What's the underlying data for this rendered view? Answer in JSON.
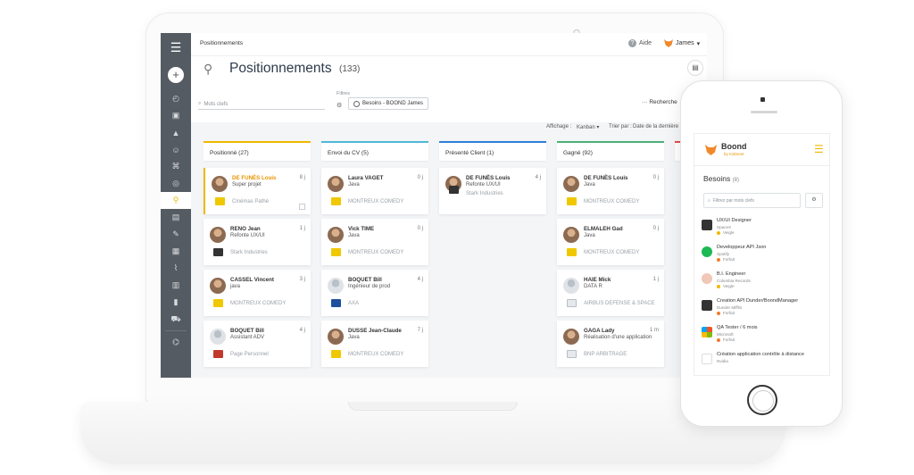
{
  "header": {
    "breadcrumb": "Positionnements",
    "help_label": "Aide",
    "user_name": "James"
  },
  "page": {
    "title": "Positionnements",
    "count": "(133)"
  },
  "filters": {
    "search_placeholder": "Mots clefs",
    "filters_label": "Filtres",
    "chip_label": "Besoins - BOOND James",
    "advanced_search": "Recherche"
  },
  "view": {
    "display_label": "Affichage :",
    "display_value": "Kanban ▾",
    "sort_label": "Trier par :",
    "sort_value": "Date de la dernière"
  },
  "kanban": {
    "columns": [
      {
        "title": "Positionné (27)",
        "color": "#f0b800",
        "cards": [
          {
            "name": "DE FUNÈS Louis",
            "role": "Super projet",
            "company": "Cinémas Pathé",
            "days": "8 j"
          },
          {
            "name": "RENO Jean",
            "role": "Refonte UX/UI",
            "company": "Stark Industries",
            "days": "1 j"
          },
          {
            "name": "CASSEL Vincent",
            "role": "java",
            "company": "MONTREUX COMEDY",
            "days": "3 j"
          },
          {
            "name": "BOQUET Bill",
            "role": "Assistant ADV",
            "company": "Page Personnel",
            "days": "4 j"
          }
        ]
      },
      {
        "title": "Envoi du CV (5)",
        "color": "#4fb8d8",
        "cards": [
          {
            "name": "Laura VAGET",
            "role": "Java",
            "company": "MONTREUX COMEDY",
            "days": "0 j"
          },
          {
            "name": "Vick TIME",
            "role": "Java",
            "company": "MONTREUX COMEDY",
            "days": "0 j"
          },
          {
            "name": "BOQUET Bill",
            "role": "Ingénieur de prod",
            "company": "AXA",
            "days": "4 j"
          },
          {
            "name": "DUSSE Jean-Claude",
            "role": "Java",
            "company": "MONTREUX COMEDY",
            "days": "7 j"
          }
        ]
      },
      {
        "title": "Présenté Client (1)",
        "color": "#2f7fd8",
        "cards": [
          {
            "name": "DE FUNÈS Louis",
            "role": "Refonte UX/UI",
            "company": "Stark Industries",
            "days": "4 j"
          }
        ]
      },
      {
        "title": "Gagné (92)",
        "color": "#4caf7a",
        "cards": [
          {
            "name": "DE FUNÈS Louis",
            "role": "Java",
            "company": "MONTREUX COMEDY",
            "days": "0 j"
          },
          {
            "name": "ELMALEH Gad",
            "role": "Java",
            "company": "MONTREUX COMEDY",
            "days": "0 j"
          },
          {
            "name": "HAIE Mick",
            "role": "DATA R",
            "company": "AIRBUS DEFENSE & SPACE",
            "days": "1 j"
          },
          {
            "name": "GAGA Lady",
            "role": "Réalisation d'une application",
            "company": "BNP ARBITRAGE",
            "days": "1 m"
          }
        ]
      }
    ]
  },
  "mobile": {
    "brand": "Boond",
    "brand_sub": "by Kidmeet",
    "section_title": "Besoins",
    "section_count": "(8)",
    "search_placeholder": "Filtrez par mots clefs",
    "items": [
      {
        "title": "UX/UI Designer",
        "company": "SpaceX",
        "status": "Veigle"
      },
      {
        "title": "Developpeur API Json",
        "company": "Spotify",
        "status": "Forfait"
      },
      {
        "title": "B.I. Engineer",
        "company": "Columbia Records",
        "status": "Veigle"
      },
      {
        "title": "Creation API Dunder/BoondManager",
        "company": "Dunder Mifflin",
        "status": "Forfait"
      },
      {
        "title": "QA Tester / 6 mois",
        "company": "Microsoft",
        "status": "Forfait"
      },
      {
        "title": "Création application contrôle à distance",
        "company": "Nvidia",
        "status": ""
      }
    ]
  }
}
